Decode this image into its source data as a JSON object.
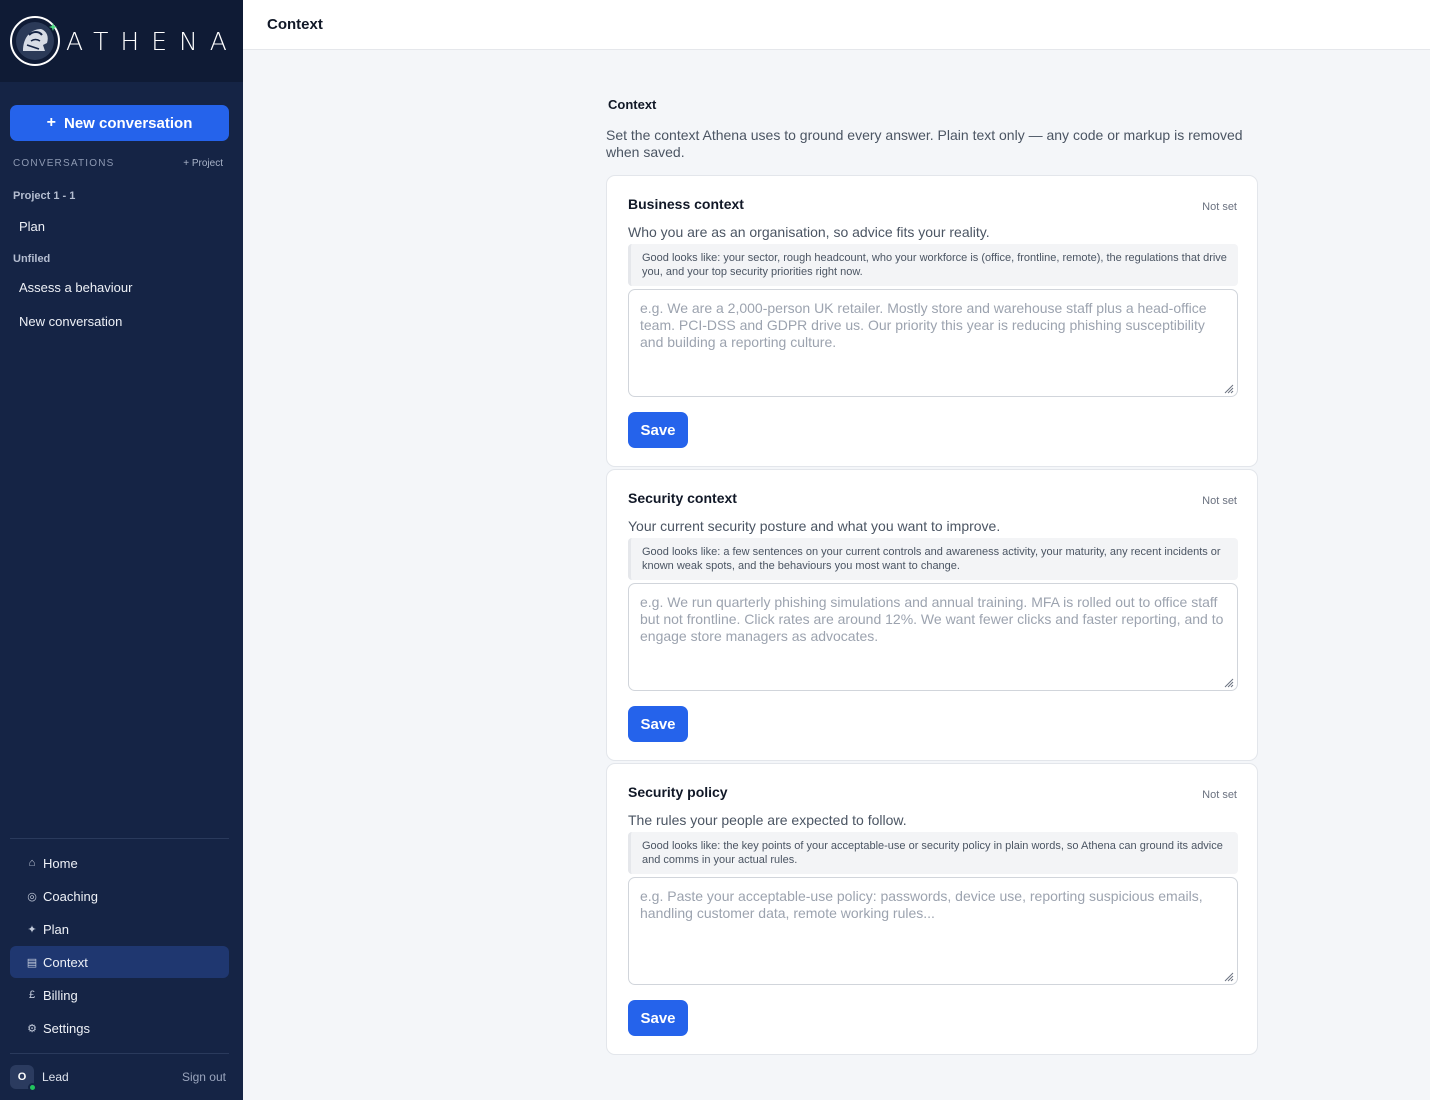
{
  "brand": {
    "name": "ATHENA",
    "logo_icon": "athena-helmet-logo"
  },
  "sidebar": {
    "new_conversation_label": "New conversation",
    "new_conversation_icon": "plus-icon",
    "conversations_heading": "CONVERSATIONS",
    "add_project_label": "+ Project",
    "groups": [
      {
        "label": "Project 1 - 1",
        "items": [
          "Plan"
        ]
      },
      {
        "label": "Unfiled",
        "items": [
          "Assess a behaviour",
          "New conversation"
        ]
      }
    ],
    "nav": [
      {
        "label": "Home",
        "icon": "⌂",
        "active": false
      },
      {
        "label": "Coaching",
        "icon": "◎",
        "active": false
      },
      {
        "label": "Plan",
        "icon": "✦",
        "active": false
      },
      {
        "label": "Context",
        "icon": "▤",
        "active": true
      },
      {
        "label": "Billing",
        "icon": "£",
        "active": false
      },
      {
        "label": "Settings",
        "icon": "⚙",
        "active": false
      }
    ],
    "user": {
      "initial": "O",
      "name": "Lead",
      "online": true
    },
    "sign_out_label": "Sign out"
  },
  "topbar": {
    "title": "Context"
  },
  "page": {
    "title": "Context",
    "description": "Set the context Athena uses to ground every answer. Plain text only — any code or markup is removed when saved."
  },
  "cards": [
    {
      "title": "Business context",
      "status": "Not set",
      "subtitle": "Who you are as an organisation, so advice fits your reality.",
      "hint": "Good looks like: your sector, rough headcount, who your workforce is (office, frontline, remote), the regulations that drive you, and your top security priorities right now.",
      "value": "",
      "placeholder": "e.g. We are a 2,000-person UK retailer. Mostly store and warehouse staff plus a head-office team. PCI-DSS and GDPR drive us. Our priority this year is reducing phishing susceptibility and building a reporting culture.",
      "save_label": "Save"
    },
    {
      "title": "Security context",
      "status": "Not set",
      "subtitle": "Your current security posture and what you want to improve.",
      "hint": "Good looks like: a few sentences on your current controls and awareness activity, your maturity, any recent incidents or known weak spots, and the behaviours you most want to change.",
      "value": "",
      "placeholder": "e.g. We run quarterly phishing simulations and annual training. MFA is rolled out to office staff but not frontline. Click rates are around 12%. We want fewer clicks and faster reporting, and to engage store managers as advocates.",
      "save_label": "Save"
    },
    {
      "title": "Security policy",
      "status": "Not set",
      "subtitle": "The rules your people are expected to follow.",
      "hint": "Good looks like: the key points of your acceptable-use or security policy in plain words, so Athena can ground its advice and comms in your actual rules.",
      "value": "",
      "placeholder": "e.g. Paste your acceptable-use policy: passwords, device use, reporting suspicious emails, handling customer data, remote working rules...",
      "save_label": "Save"
    }
  ],
  "colors": {
    "sidebar_bg": "#152445",
    "brand_bg": "#0f1b35",
    "accent": "#2563eb",
    "nav_active": "#1f3770",
    "online": "#22c55e"
  }
}
